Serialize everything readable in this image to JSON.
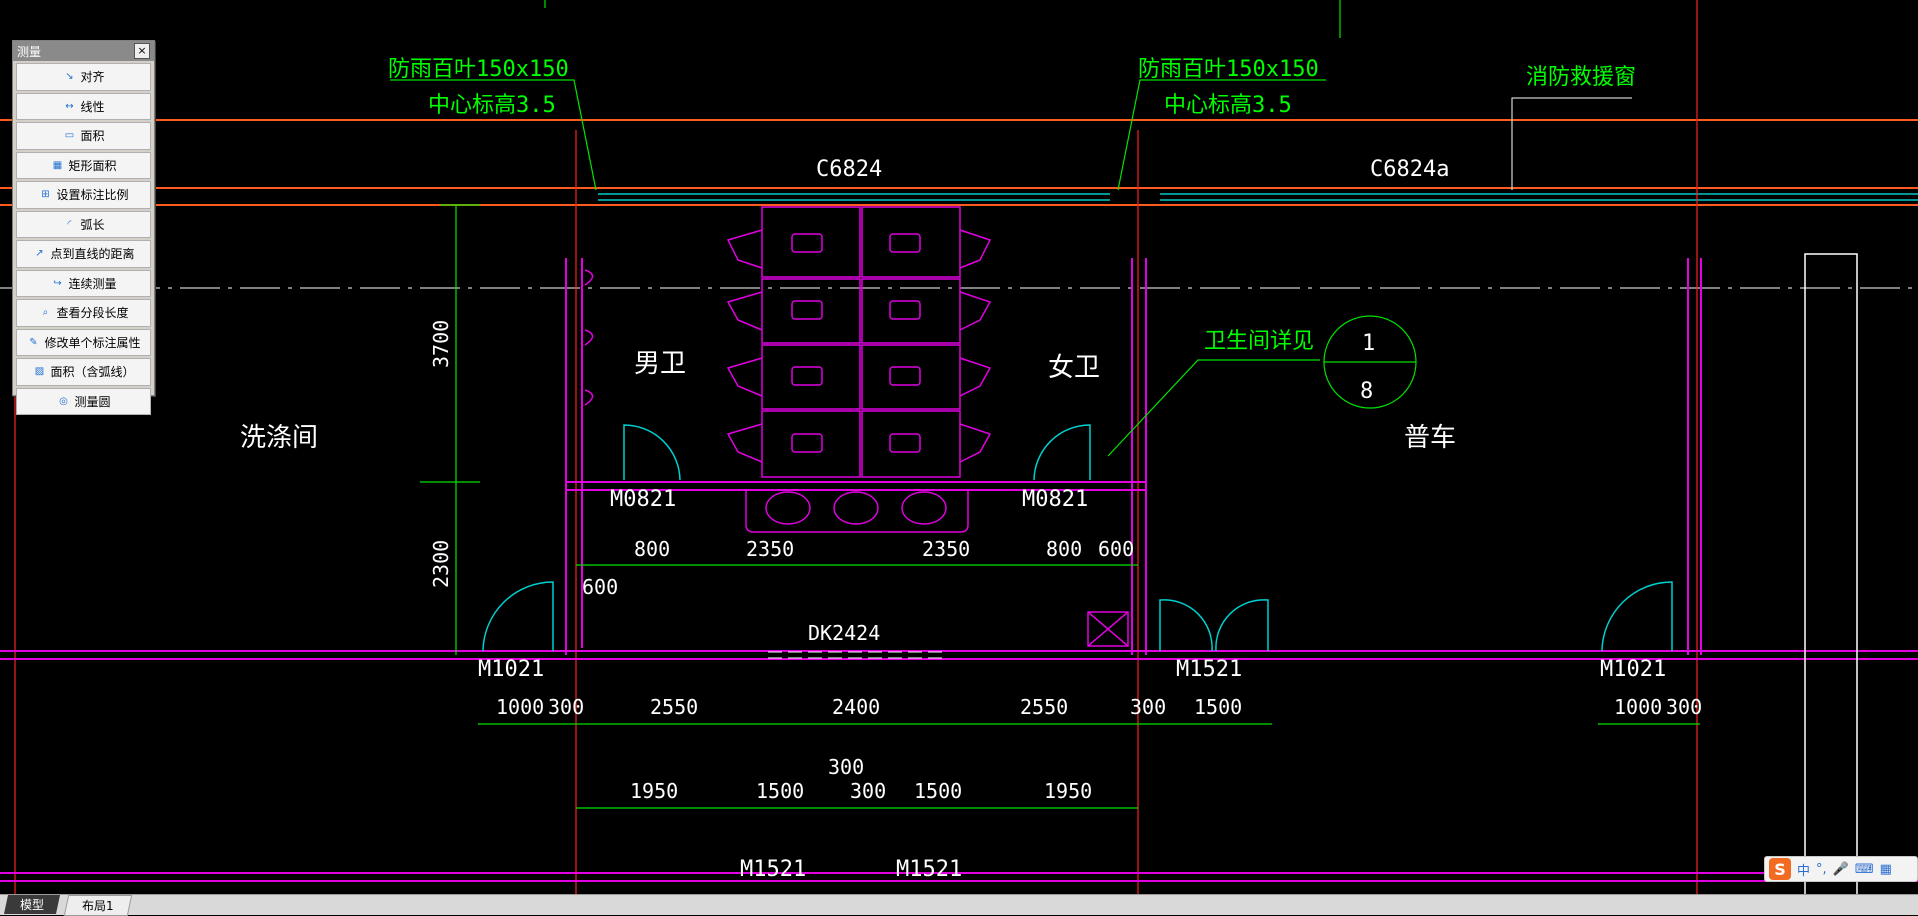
{
  "palette": {
    "title": "测量",
    "close": "×",
    "items": [
      {
        "label": "对齐",
        "icon": "align-icon"
      },
      {
        "label": "线性",
        "icon": "linear-icon"
      },
      {
        "label": "面积",
        "icon": "area-icon"
      },
      {
        "label": "矩形面积",
        "icon": "rect-area-icon"
      },
      {
        "label": "设置标注比例",
        "icon": "scale-icon"
      },
      {
        "label": "弧长",
        "icon": "arc-icon"
      },
      {
        "label": "点到直线的距离",
        "icon": "point-line-icon"
      },
      {
        "label": "连续测量",
        "icon": "continuous-icon"
      },
      {
        "label": "查看分段长度",
        "icon": "segment-icon"
      },
      {
        "label": "修改单个标注属性",
        "icon": "edit-dim-icon"
      },
      {
        "label": "面积（含弧线）",
        "icon": "arc-area-icon"
      },
      {
        "label": "测量圆",
        "icon": "circle-icon"
      }
    ]
  },
  "drawing": {
    "louver_left_1": "防雨百叶150x150",
    "louver_left_2": "中心标高3.5",
    "louver_right_1": "防雨百叶150x150",
    "louver_right_2": "中心标高3.5",
    "fire_window": "消防救援窗",
    "window_c1": "C6824",
    "window_c2": "C6824a",
    "room_laundry": "洗涤间",
    "room_male": "男卫",
    "room_female": "女卫",
    "room_general": "普车",
    "detail_note": "卫生间详见",
    "detail_num": "1",
    "detail_sheet": "8",
    "door_m0821_a": "M0821",
    "door_m0821_b": "M0821",
    "door_m1021_a": "M1021",
    "door_m1021_b": "M1021",
    "door_m1521_a": "M1521",
    "door_m1521_b": "M1521",
    "door_m1521_c": "M1521",
    "opening_dk": "DK2424",
    "dim_v_3700": "3700",
    "dim_v_2300": "2300",
    "dim_row1": [
      "800",
      "2350",
      "2350",
      "800",
      "600"
    ],
    "dim_600_left": "600",
    "dim_row2": [
      "1000",
      "300",
      "2550",
      "2400",
      "2550",
      "300",
      "1500"
    ],
    "dim_row2_right": [
      "1000",
      "300"
    ],
    "dim_300_top": "300",
    "dim_row3": [
      "1950",
      "1500",
      "300",
      "1500",
      "1950"
    ]
  },
  "tabs": {
    "model": "模型",
    "layout": "布局1"
  },
  "ime": {
    "lang": "中",
    "punct": "°,",
    "mic": "🎤",
    "keyboard": "⌨",
    "grid": "▦",
    "logo": "S"
  },
  "colors": {
    "wall": "#ff5a1f",
    "dim": "#00e400",
    "note": "#00ff00",
    "fixture": "#e000e0",
    "door": "#00d0d0",
    "text": "#ffffff",
    "grid": "#ff2020"
  }
}
